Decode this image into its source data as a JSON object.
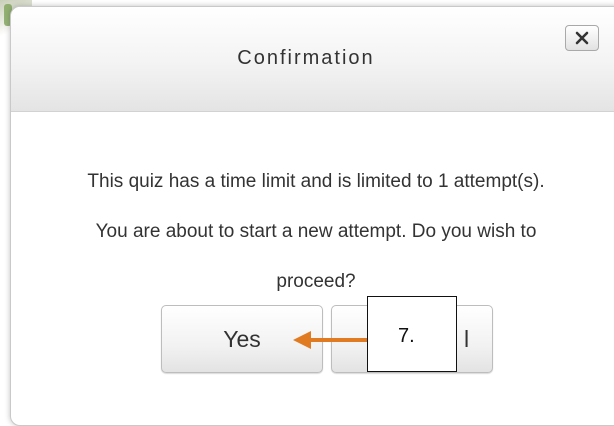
{
  "dialog": {
    "title": "Confirmation",
    "close_icon": "close-x-icon",
    "message": "This quiz has a time limit and is limited to 1 attempt(s). You are about to start a new attempt. Do you wish to proceed?",
    "yes_label": "Yes",
    "cancel_label_visible": "l"
  },
  "annotation": {
    "callout_label": "7.",
    "arrow_color": "#e07b22",
    "arrow_icon": "left-arrow-icon"
  }
}
